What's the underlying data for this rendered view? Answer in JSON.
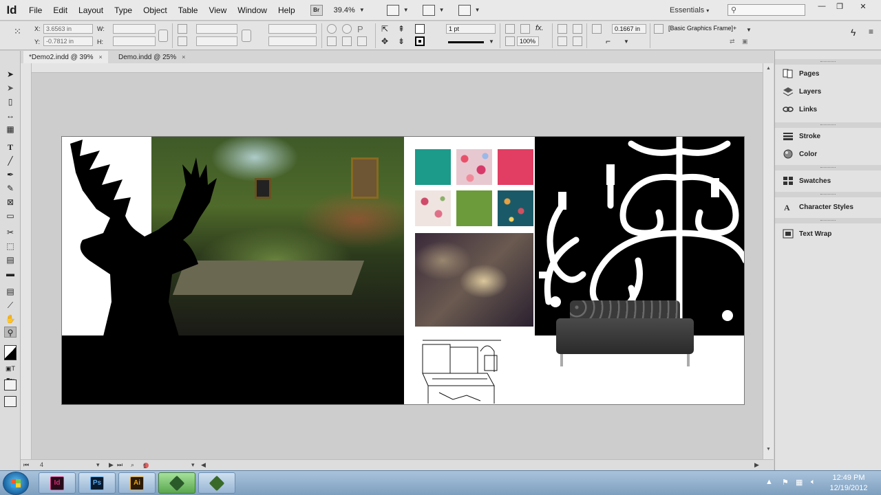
{
  "app": {
    "logo": "Id",
    "menu": [
      "File",
      "Edit",
      "Layout",
      "Type",
      "Object",
      "Table",
      "View",
      "Window",
      "Help"
    ],
    "bridge": "Br",
    "zoom": "39.4%",
    "workspace": "Essentials"
  },
  "control": {
    "x_label": "X:",
    "x_value": "3.6563 in",
    "y_label": "Y:",
    "y_value": "-0.7812 in",
    "w_label": "W:",
    "h_label": "H:",
    "stroke_weight": "1 pt",
    "opacity": "100%",
    "offset": "0.1667 in",
    "object_style": "[Basic Graphics Frame]+"
  },
  "tabs": [
    {
      "label": "*Demo2.indd @ 39%",
      "close": "×"
    },
    {
      "label": "Demo.indd @ 25%",
      "close": "×"
    }
  ],
  "tools": [
    "selection-tool",
    "direct-selection-tool",
    "page-tool",
    "gap-tool",
    "content-collector-tool",
    "type-tool",
    "line-tool",
    "pen-tool",
    "pencil-tool",
    "rectangle-frame-tool",
    "rectangle-tool",
    "scissors-tool",
    "free-transform-tool",
    "gradient-swatch-tool",
    "gradient-feather-tool",
    "note-tool",
    "eyedropper-tool",
    "hand-tool",
    "zoom-tool"
  ],
  "panels": [
    {
      "label": "Pages",
      "icon": "pages-icon"
    },
    {
      "label": "Layers",
      "icon": "layers-icon"
    },
    {
      "label": "Links",
      "icon": "links-icon"
    },
    {
      "label": "Stroke",
      "icon": "stroke-icon"
    },
    {
      "label": "Color",
      "icon": "color-icon"
    },
    {
      "label": "Swatches",
      "icon": "swatches-icon"
    },
    {
      "label": "Character Styles",
      "icon": "character-styles-icon"
    },
    {
      "label": "Text Wrap",
      "icon": "text-wrap-icon"
    }
  ],
  "status": {
    "page": "4",
    "errors": "1 error"
  },
  "taskbar": {
    "apps": [
      {
        "name": "indesign",
        "label": "Id",
        "color": "#d42b74"
      },
      {
        "name": "photoshop",
        "label": "Ps",
        "color": "#1b5ea8"
      },
      {
        "name": "illustrator",
        "label": "Ai",
        "color": "#e8a21b"
      }
    ],
    "time": "12:49 PM",
    "date": "12/19/2012"
  },
  "colors": {
    "teal_swatch": "#1c9a8a",
    "pink_swatch": "#e23d62",
    "green_swatch": "#6b9b3a",
    "indesign_brand": "#d42b74"
  }
}
